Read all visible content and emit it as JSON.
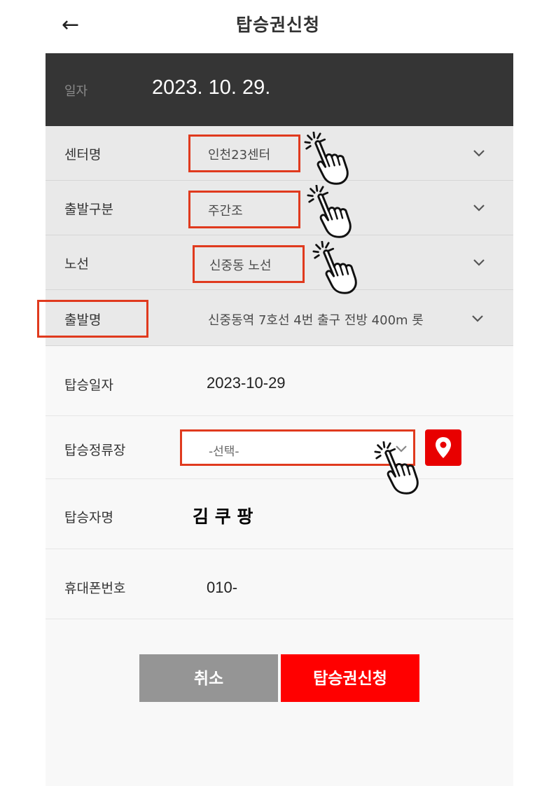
{
  "header": {
    "back_icon": "←",
    "title": "탑승권신청"
  },
  "date_bar": {
    "label": "일자",
    "value": "2023. 10. 29."
  },
  "center": {
    "label": "센터명",
    "value": "인천23센터"
  },
  "departure_type": {
    "label": "출발구분",
    "value": "주간조"
  },
  "route": {
    "label": "노선",
    "value": "신중동 노선"
  },
  "departure_name": {
    "label": "출발명",
    "value": "신중동역 7호선 4번 출구 전방 400m 롯"
  },
  "boarding_date": {
    "label": "탑승일자",
    "value": "2023-10-29"
  },
  "boarding_stop": {
    "label": "탑승정류장",
    "placeholder": "-선택-"
  },
  "passenger_name": {
    "label": "탑승자명",
    "value": "김 쿠 팡"
  },
  "phone": {
    "label": "휴대폰번호",
    "value": "010-"
  },
  "actions": {
    "cancel_label": "취소",
    "submit_label": "탑승권신청"
  },
  "colors": {
    "accent_red": "#ff0000",
    "highlight_border": "#e03a1e",
    "date_bar_bg": "#353535",
    "cancel_gray": "#959595"
  },
  "icons": [
    "arrow-left-icon",
    "chevron-down-icon",
    "map-pin-icon",
    "pointing-hand-icon"
  ]
}
